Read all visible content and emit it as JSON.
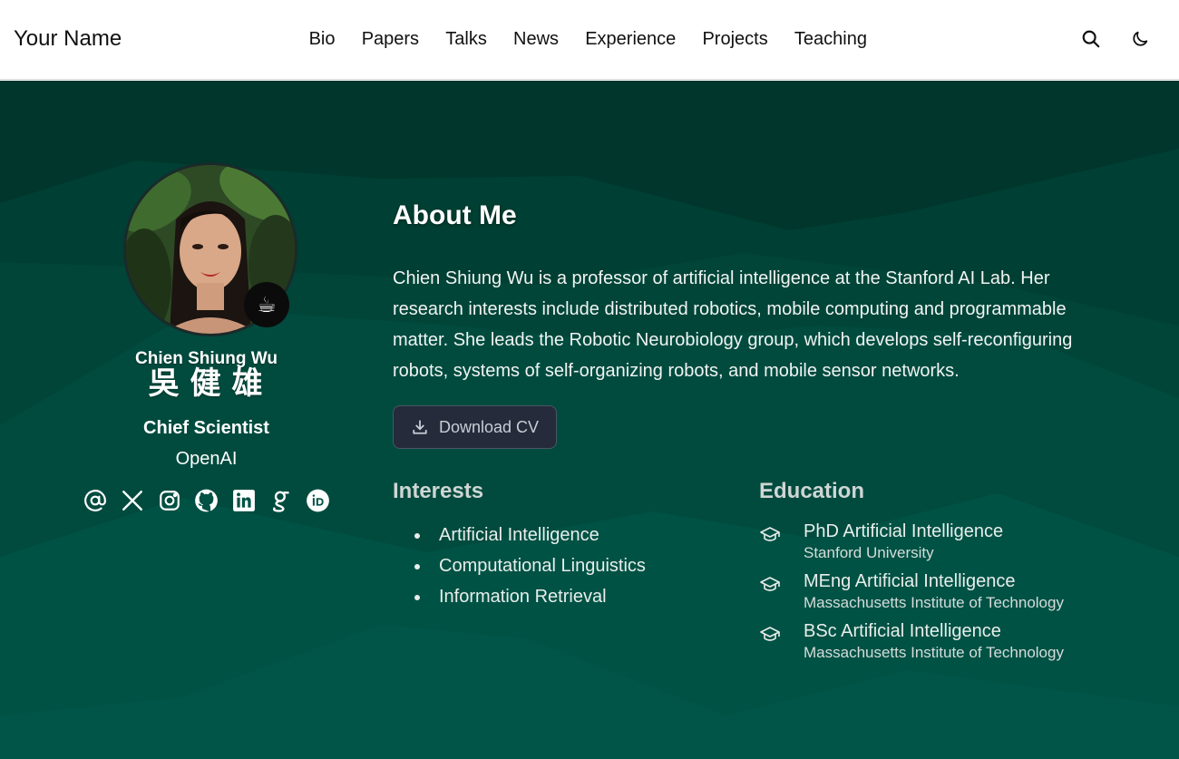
{
  "navbar": {
    "brand": "Your Name",
    "links": [
      "Bio",
      "Papers",
      "Talks",
      "News",
      "Experience",
      "Projects",
      "Teaching"
    ],
    "search_icon": "search-icon",
    "theme_icon": "moon-icon"
  },
  "profile": {
    "name": "Chien Shiung Wu",
    "name_cjk": "吳健雄",
    "role": "Chief Scientist",
    "organization": "OpenAI",
    "status_emoji": "☕",
    "socials": [
      "email-icon",
      "x-icon",
      "instagram-icon",
      "github-icon",
      "linkedin-icon",
      "google-scholar-icon",
      "orcid-icon"
    ]
  },
  "about": {
    "title": "About Me",
    "bio": "Chien Shiung Wu is a professor of artificial intelligence at the Stanford AI Lab. Her research interests include distributed robotics, mobile computing and programmable matter. She leads the Robotic Neurobiology group, which develops self-reconfiguring robots, systems of self-organizing robots, and mobile sensor networks.",
    "cv_button": "Download CV"
  },
  "interests": {
    "title": "Interests",
    "items": [
      "Artificial Intelligence",
      "Computational Linguistics",
      "Information Retrieval"
    ]
  },
  "education": {
    "title": "Education",
    "items": [
      {
        "degree": "PhD Artificial Intelligence",
        "school": "Stanford University"
      },
      {
        "degree": "MEng Artificial Intelligence",
        "school": "Massachusetts Institute of Technology"
      },
      {
        "degree": "BSc Artificial Intelligence",
        "school": "Massachusetts Institute of Technology"
      }
    ]
  },
  "colors": {
    "hero_base": "#005244",
    "hero_dark": "#00362b",
    "button_bg": "#252b3a"
  }
}
